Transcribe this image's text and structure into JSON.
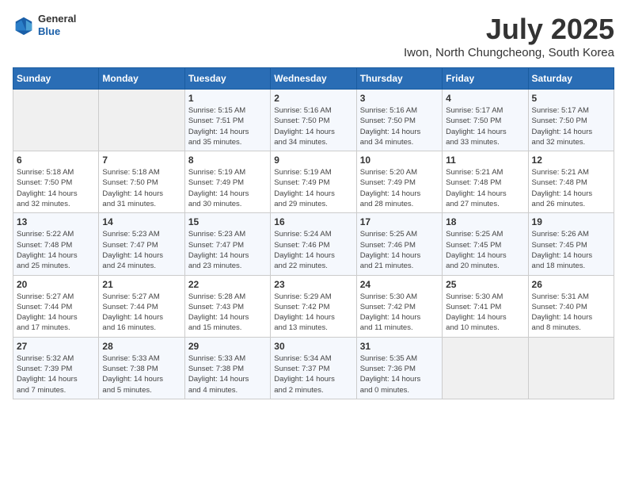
{
  "logo": {
    "general": "General",
    "blue": "Blue"
  },
  "header": {
    "month": "July 2025",
    "location": "Iwon, North Chungcheong, South Korea"
  },
  "weekdays": [
    "Sunday",
    "Monday",
    "Tuesday",
    "Wednesday",
    "Thursday",
    "Friday",
    "Saturday"
  ],
  "weeks": [
    [
      {
        "day": "",
        "info": ""
      },
      {
        "day": "",
        "info": ""
      },
      {
        "day": "1",
        "info": "Sunrise: 5:15 AM\nSunset: 7:51 PM\nDaylight: 14 hours\nand 35 minutes."
      },
      {
        "day": "2",
        "info": "Sunrise: 5:16 AM\nSunset: 7:50 PM\nDaylight: 14 hours\nand 34 minutes."
      },
      {
        "day": "3",
        "info": "Sunrise: 5:16 AM\nSunset: 7:50 PM\nDaylight: 14 hours\nand 34 minutes."
      },
      {
        "day": "4",
        "info": "Sunrise: 5:17 AM\nSunset: 7:50 PM\nDaylight: 14 hours\nand 33 minutes."
      },
      {
        "day": "5",
        "info": "Sunrise: 5:17 AM\nSunset: 7:50 PM\nDaylight: 14 hours\nand 32 minutes."
      }
    ],
    [
      {
        "day": "6",
        "info": "Sunrise: 5:18 AM\nSunset: 7:50 PM\nDaylight: 14 hours\nand 32 minutes."
      },
      {
        "day": "7",
        "info": "Sunrise: 5:18 AM\nSunset: 7:50 PM\nDaylight: 14 hours\nand 31 minutes."
      },
      {
        "day": "8",
        "info": "Sunrise: 5:19 AM\nSunset: 7:49 PM\nDaylight: 14 hours\nand 30 minutes."
      },
      {
        "day": "9",
        "info": "Sunrise: 5:19 AM\nSunset: 7:49 PM\nDaylight: 14 hours\nand 29 minutes."
      },
      {
        "day": "10",
        "info": "Sunrise: 5:20 AM\nSunset: 7:49 PM\nDaylight: 14 hours\nand 28 minutes."
      },
      {
        "day": "11",
        "info": "Sunrise: 5:21 AM\nSunset: 7:48 PM\nDaylight: 14 hours\nand 27 minutes."
      },
      {
        "day": "12",
        "info": "Sunrise: 5:21 AM\nSunset: 7:48 PM\nDaylight: 14 hours\nand 26 minutes."
      }
    ],
    [
      {
        "day": "13",
        "info": "Sunrise: 5:22 AM\nSunset: 7:48 PM\nDaylight: 14 hours\nand 25 minutes."
      },
      {
        "day": "14",
        "info": "Sunrise: 5:23 AM\nSunset: 7:47 PM\nDaylight: 14 hours\nand 24 minutes."
      },
      {
        "day": "15",
        "info": "Sunrise: 5:23 AM\nSunset: 7:47 PM\nDaylight: 14 hours\nand 23 minutes."
      },
      {
        "day": "16",
        "info": "Sunrise: 5:24 AM\nSunset: 7:46 PM\nDaylight: 14 hours\nand 22 minutes."
      },
      {
        "day": "17",
        "info": "Sunrise: 5:25 AM\nSunset: 7:46 PM\nDaylight: 14 hours\nand 21 minutes."
      },
      {
        "day": "18",
        "info": "Sunrise: 5:25 AM\nSunset: 7:45 PM\nDaylight: 14 hours\nand 20 minutes."
      },
      {
        "day": "19",
        "info": "Sunrise: 5:26 AM\nSunset: 7:45 PM\nDaylight: 14 hours\nand 18 minutes."
      }
    ],
    [
      {
        "day": "20",
        "info": "Sunrise: 5:27 AM\nSunset: 7:44 PM\nDaylight: 14 hours\nand 17 minutes."
      },
      {
        "day": "21",
        "info": "Sunrise: 5:27 AM\nSunset: 7:44 PM\nDaylight: 14 hours\nand 16 minutes."
      },
      {
        "day": "22",
        "info": "Sunrise: 5:28 AM\nSunset: 7:43 PM\nDaylight: 14 hours\nand 15 minutes."
      },
      {
        "day": "23",
        "info": "Sunrise: 5:29 AM\nSunset: 7:42 PM\nDaylight: 14 hours\nand 13 minutes."
      },
      {
        "day": "24",
        "info": "Sunrise: 5:30 AM\nSunset: 7:42 PM\nDaylight: 14 hours\nand 11 minutes."
      },
      {
        "day": "25",
        "info": "Sunrise: 5:30 AM\nSunset: 7:41 PM\nDaylight: 14 hours\nand 10 minutes."
      },
      {
        "day": "26",
        "info": "Sunrise: 5:31 AM\nSunset: 7:40 PM\nDaylight: 14 hours\nand 8 minutes."
      }
    ],
    [
      {
        "day": "27",
        "info": "Sunrise: 5:32 AM\nSunset: 7:39 PM\nDaylight: 14 hours\nand 7 minutes."
      },
      {
        "day": "28",
        "info": "Sunrise: 5:33 AM\nSunset: 7:38 PM\nDaylight: 14 hours\nand 5 minutes."
      },
      {
        "day": "29",
        "info": "Sunrise: 5:33 AM\nSunset: 7:38 PM\nDaylight: 14 hours\nand 4 minutes."
      },
      {
        "day": "30",
        "info": "Sunrise: 5:34 AM\nSunset: 7:37 PM\nDaylight: 14 hours\nand 2 minutes."
      },
      {
        "day": "31",
        "info": "Sunrise: 5:35 AM\nSunset: 7:36 PM\nDaylight: 14 hours\nand 0 minutes."
      },
      {
        "day": "",
        "info": ""
      },
      {
        "day": "",
        "info": ""
      }
    ]
  ]
}
